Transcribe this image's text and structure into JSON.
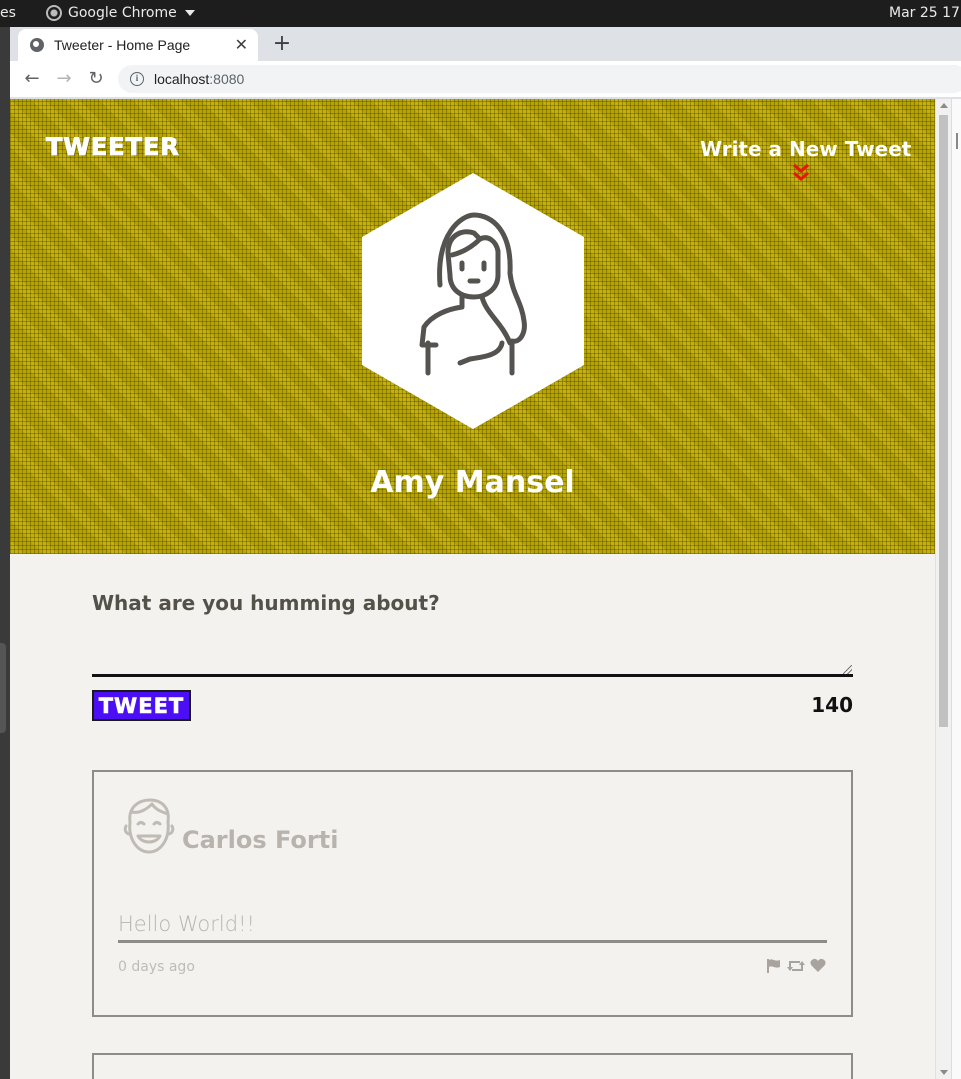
{
  "os": {
    "left_clip_text": "es",
    "app_name": "Google Chrome",
    "clock": "Mar 25  17:"
  },
  "browser": {
    "tab_title": "Tweeter - Home Page",
    "tab_close": "✕",
    "new_tab": "+",
    "url_host": "localhost",
    "url_port": ":8080",
    "back": "←",
    "forward": "→",
    "reload": "↻"
  },
  "page": {
    "brand": "TWEETER",
    "compose_link": "Write a New Tweet",
    "profile_name": "Amy Mansel",
    "compose_prompt": "What are you humming about?",
    "compose_value": "",
    "tweet_button": "TWEET",
    "char_counter": "140",
    "colors": {
      "hero": "#b8a400",
      "tweet_button": "#4b0ef5",
      "chevron": "#e8170c",
      "page_bg": "#f4f2ef"
    }
  },
  "tweets": [
    {
      "author": "Carlos Forti",
      "text": "Hello World!!",
      "time": "0 days ago",
      "actions": [
        "flag-icon",
        "retweet-icon",
        "heart-icon"
      ]
    }
  ]
}
